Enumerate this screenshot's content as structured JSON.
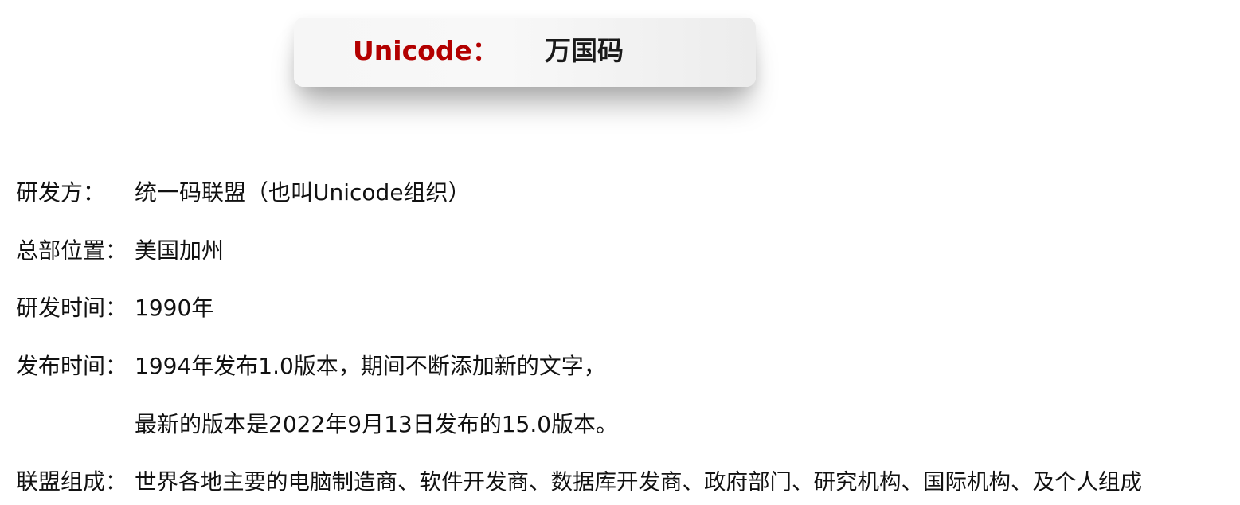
{
  "header": {
    "key": "Unicode：",
    "value": "万国码"
  },
  "rows": [
    {
      "label": "研发方：",
      "value": "统一码联盟（也叫Unicode组织）"
    },
    {
      "label": "总部位置：",
      "value": "美国加州"
    },
    {
      "label": "研发时间：",
      "value": "1990年"
    },
    {
      "label": "发布时间：",
      "value": "1994年发布1.0版本，期间不断添加新的文字，"
    },
    {
      "label": "",
      "value": "最新的版本是2022年9月13日发布的15.0版本。"
    },
    {
      "label": "联盟组成：",
      "value": "世界各地主要的电脑制造商、软件开发商、数据库开发商、政府部门、研究机构、国际机构、及个人组成"
    }
  ]
}
